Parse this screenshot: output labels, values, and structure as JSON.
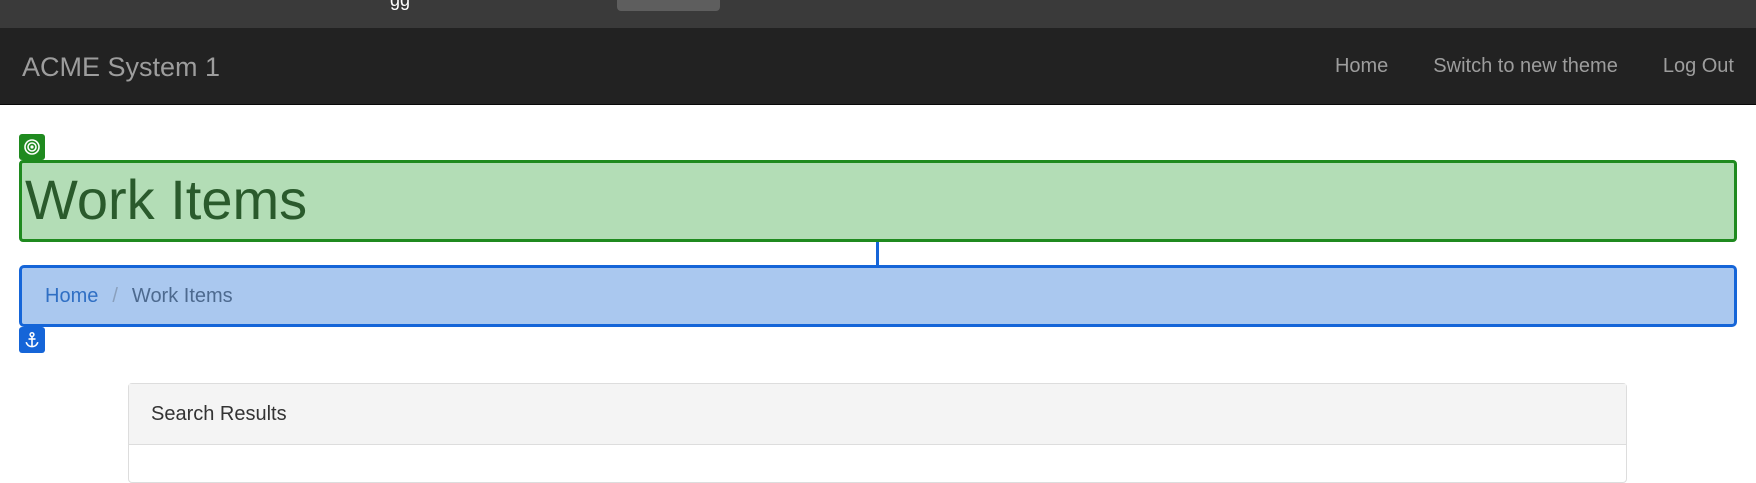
{
  "top_strip": {
    "text": "gg"
  },
  "navbar": {
    "brand": "ACME System 1",
    "links": [
      {
        "label": "Home"
      },
      {
        "label": "Switch to new theme"
      },
      {
        "label": "Log Out"
      }
    ]
  },
  "page": {
    "title": "Work Items"
  },
  "breadcrumb": {
    "items": [
      {
        "label": "Home"
      },
      {
        "label": "Work Items"
      }
    ],
    "separator": "/"
  },
  "panel": {
    "heading": "Search Results"
  },
  "icons": {
    "target": "target-icon",
    "anchor": "anchor-icon"
  },
  "colors": {
    "navbar_bg": "#222222",
    "heading_highlight_fill": "#b3ddb6",
    "heading_highlight_border": "#1f8a1f",
    "breadcrumb_highlight_fill": "#aac8ef",
    "breadcrumb_highlight_border": "#1565d8"
  }
}
